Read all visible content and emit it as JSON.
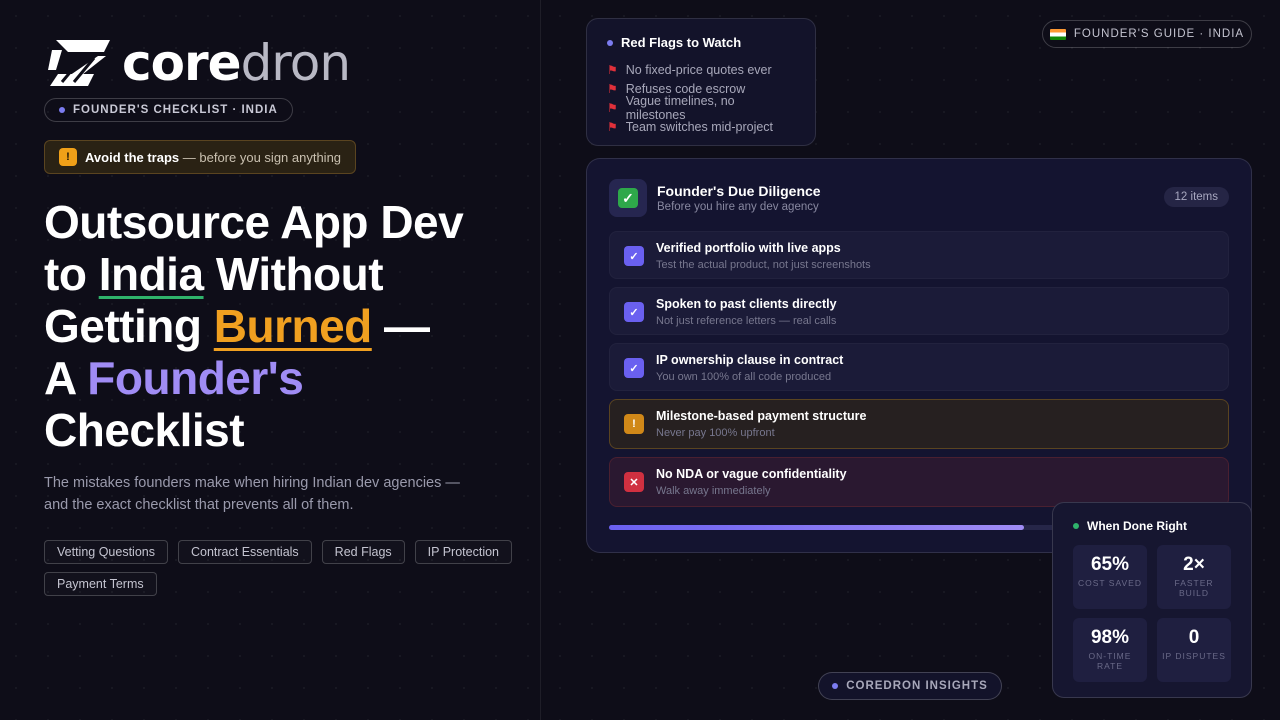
{
  "brand": {
    "logo_core": "core",
    "logo_dron": "dron",
    "checklist_pill": "FOUNDER'S CHECKLIST · INDIA"
  },
  "warning": {
    "icon": "!",
    "strong": "Avoid the traps",
    "rest": " — before you sign anything"
  },
  "headline": {
    "line1": "Outsource App Dev",
    "line2_pre": "to ",
    "line2_india": "India",
    "line2_post": " Without",
    "line3_pre": "Getting ",
    "line3_burned": "Burned",
    "line3_post": " —",
    "line4_pre": "A ",
    "line4_founder": "Founder's",
    "line5": "Checklist"
  },
  "subtitle": "The mistakes founders make when hiring Indian dev agencies — and the exact checklist that prevents all of them.",
  "tags": [
    "Vetting Questions",
    "Contract Essentials",
    "Red Flags",
    "IP Protection",
    "Payment Terms"
  ],
  "red_flags": {
    "title": "Red Flags to Watch",
    "items": [
      "No fixed-price quotes ever",
      "Refuses code escrow",
      "Vague timelines, no milestones",
      "Team switches mid-project"
    ]
  },
  "guide_pill": "FOUNDER'S GUIDE · INDIA",
  "due_diligence": {
    "title": "Founder's Due Diligence",
    "subtitle": "Before you hire any dev agency",
    "count": "12 items",
    "items": [
      {
        "title": "Verified portfolio with live apps",
        "sub": "Test the actual product, not just screenshots",
        "status": "ok",
        "icon": "✓"
      },
      {
        "title": "Spoken to past clients directly",
        "sub": "Not just reference letters — real calls",
        "status": "ok",
        "icon": "✓"
      },
      {
        "title": "IP ownership clause in contract",
        "sub": "You own 100% of all code produced",
        "status": "ok",
        "icon": "✓"
      },
      {
        "title": "Milestone-based payment structure",
        "sub": "Never pay 100% upfront",
        "status": "warn",
        "icon": "!"
      },
      {
        "title": "No NDA or vague confidentiality",
        "sub": "Walk away immediately",
        "status": "bad",
        "icon": "✕"
      }
    ],
    "progress": 0.67
  },
  "results": {
    "title": "When Done Right",
    "stats": [
      {
        "value": "65%",
        "label": "COST SAVED"
      },
      {
        "value": "2×",
        "label": "FASTER BUILD"
      },
      {
        "value": "98%",
        "label": "ON-TIME RATE"
      },
      {
        "value": "0",
        "label": "IP DISPUTES"
      }
    ]
  },
  "insights_pill": "COREDRON INSIGHTS",
  "colors": {
    "accent": "#6a60f0",
    "orange": "#f0a020",
    "violet": "#a08cf5",
    "green": "#2fb36b",
    "red": "#d03040"
  }
}
